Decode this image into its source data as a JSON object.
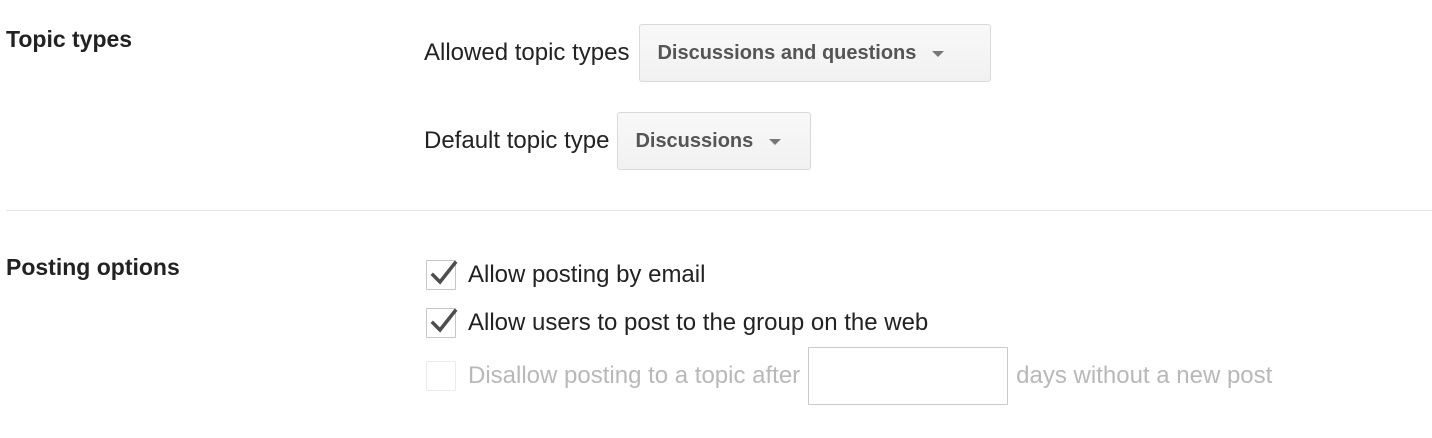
{
  "topic_types": {
    "title": "Topic types",
    "allowed": {
      "label": "Allowed topic types",
      "value": "Discussions and questions"
    },
    "default": {
      "label": "Default topic type",
      "value": "Discussions"
    }
  },
  "posting_options": {
    "title": "Posting options",
    "options": [
      {
        "label": "Allow posting by email",
        "checked": true,
        "enabled": true
      },
      {
        "label": "Allow users to post to the group on the web",
        "checked": true,
        "enabled": true
      },
      {
        "label": "Disallow posting to a topic after",
        "checked": false,
        "enabled": false
      }
    ],
    "days_input": {
      "value": "",
      "placeholder": ""
    },
    "days_suffix": "days without a new post"
  },
  "icons": {
    "dropdown_caret": "caret-down-icon",
    "checkmark": "checkmark-icon"
  },
  "colors": {
    "text": "#222222",
    "disabled_text": "#b8b8b8",
    "checkmark": "#4d4d4d",
    "button_border": "#d9d9d9"
  }
}
